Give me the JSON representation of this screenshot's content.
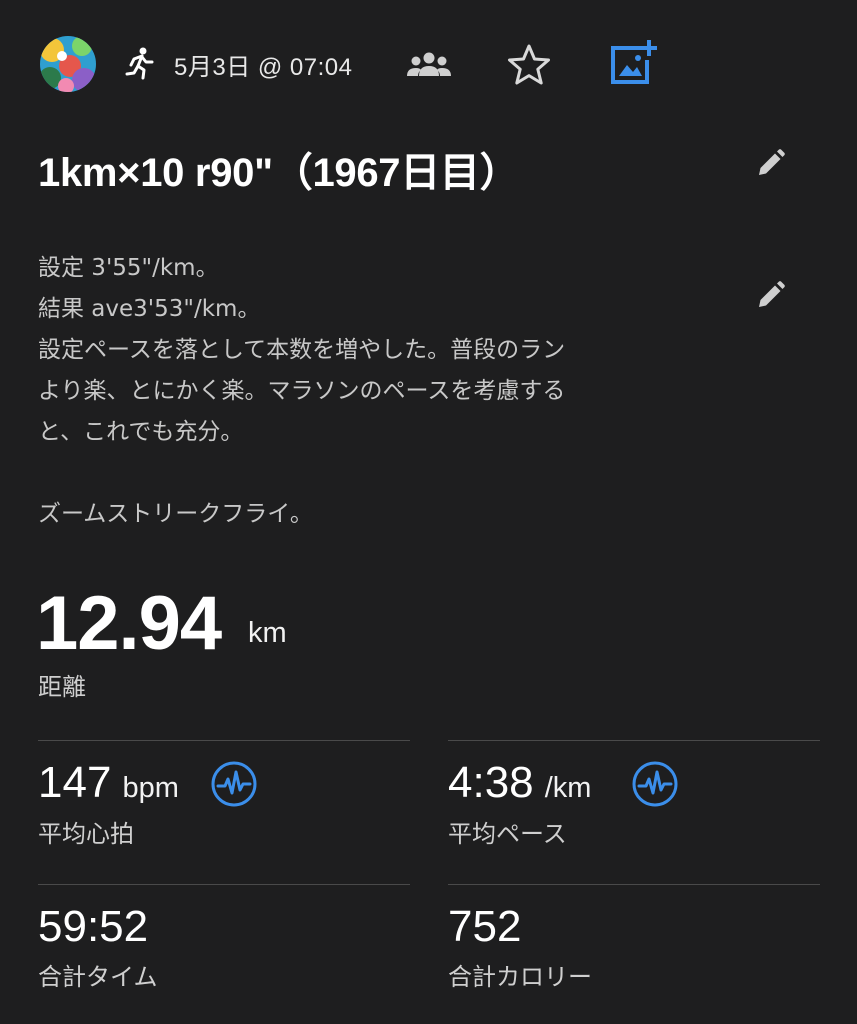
{
  "header": {
    "date_time": "5月3日 @ 07:04",
    "avatar_icon": "avatar-image",
    "activity_icon": "running-icon",
    "icons": [
      "group-icon",
      "star-icon",
      "add-photo-icon"
    ],
    "accent_color": "#3b8eea"
  },
  "activity": {
    "title": "1km×10 r90\"（1967日目）",
    "description": "設定 3'55\"/km。\n結果 ave3'53\"/km。\n設定ペースを落として本数を増やした。普段のラン\nより楽、とにかく楽。マラソンのペースを考慮する\nと、これでも充分。\n\nズームストリークフライ。"
  },
  "distance": {
    "value": "12.94",
    "unit": "km",
    "label": "距離"
  },
  "stats": {
    "heart_rate": {
      "value": "147",
      "unit": "bpm",
      "label": "平均心拍"
    },
    "pace": {
      "value": "4:38",
      "unit": "/km",
      "label": "平均ペース"
    },
    "time": {
      "value": "59:52",
      "label": "合計タイム"
    },
    "calories": {
      "value": "752",
      "label": "合計カロリー"
    }
  }
}
